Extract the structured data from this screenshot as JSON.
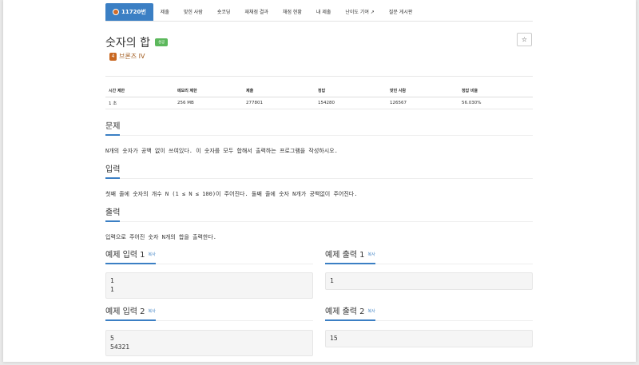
{
  "tabs": [
    {
      "label": "11720번",
      "active": true
    },
    {
      "label": "제출"
    },
    {
      "label": "맞힌 사람"
    },
    {
      "label": "숏코딩"
    },
    {
      "label": "재채점 결과"
    },
    {
      "label": "채점 현황"
    },
    {
      "label": "내 제출"
    },
    {
      "label": "난이도 기여"
    },
    {
      "label": "질문 게시판"
    }
  ],
  "problem": {
    "title": "숫자의 합",
    "badge": "성공",
    "star": "☆",
    "tier": "브론즈 IV"
  },
  "stats": {
    "headers": [
      "시간 제한",
      "메모리 제한",
      "제출",
      "정답",
      "맞힌 사람",
      "정답 비율"
    ],
    "values": [
      "1 초",
      "256 MB",
      "277801",
      "154280",
      "126567",
      "56.030%"
    ]
  },
  "sections": {
    "problem_head": "문제",
    "problem_text": "N개의 숫자가 공백 없이 쓰여있다. 이 숫자를 모두 합해서 출력하는 프로그램을 작성하시오.",
    "input_head": "입력",
    "input_text": "첫째 줄에 숫자의 개수 N (1 ≤ N ≤ 100)이 주어진다. 둘째 줄에 숫자 N개가 공백없이 주어진다.",
    "output_head": "출력",
    "output_text": "입력으로 주어진 숫자 N개의 합을 출력한다."
  },
  "examples": {
    "copy_label": "복사",
    "in1_head": "예제 입력 1",
    "in1": "1\n1",
    "out1_head": "예제 출력 1",
    "out1": "1",
    "in2_head": "예제 입력 2",
    "in2": "5\n54321",
    "out2_head": "예제 출력 2",
    "out2": "15"
  },
  "colors": {
    "accent": "#3b7fc4",
    "success": "#5cb85c",
    "bronze": "#c8661f"
  }
}
